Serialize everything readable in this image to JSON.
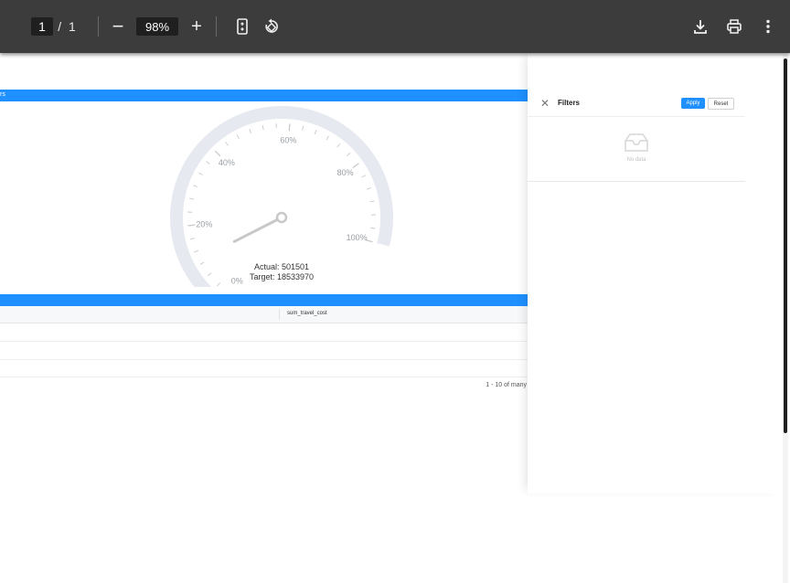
{
  "toolbar": {
    "page_current": "1",
    "page_total_separator": "/",
    "page_total": "1",
    "zoom_out": "−",
    "zoom_value": "98%",
    "zoom_in": "+",
    "icons": [
      "fit-page-icon",
      "rotate-icon",
      "download-icon",
      "print-icon",
      "more-options-icon"
    ]
  },
  "report": {
    "top_bar_label": "rs",
    "gauge": {
      "labels": [
        "0%",
        "20%",
        "40%",
        "60%",
        "80%",
        "100%"
      ],
      "actual_text": "Actual: 501501",
      "target_text": "Target: 18533970",
      "value_fraction": 0.027
    },
    "table": {
      "column_header": "sum_travel_cost",
      "pager_text": "1 - 10 of many"
    }
  },
  "filters": {
    "title": "Filters",
    "apply_label": "Apply",
    "reset_label": "Reset",
    "empty_text": "No data"
  },
  "colors": {
    "toolbar_bg": "#3c3c3c",
    "accent_blue": "#1e90ff",
    "gauge_track": "#e7e9f1",
    "gauge_fill": "#2ecc71"
  }
}
